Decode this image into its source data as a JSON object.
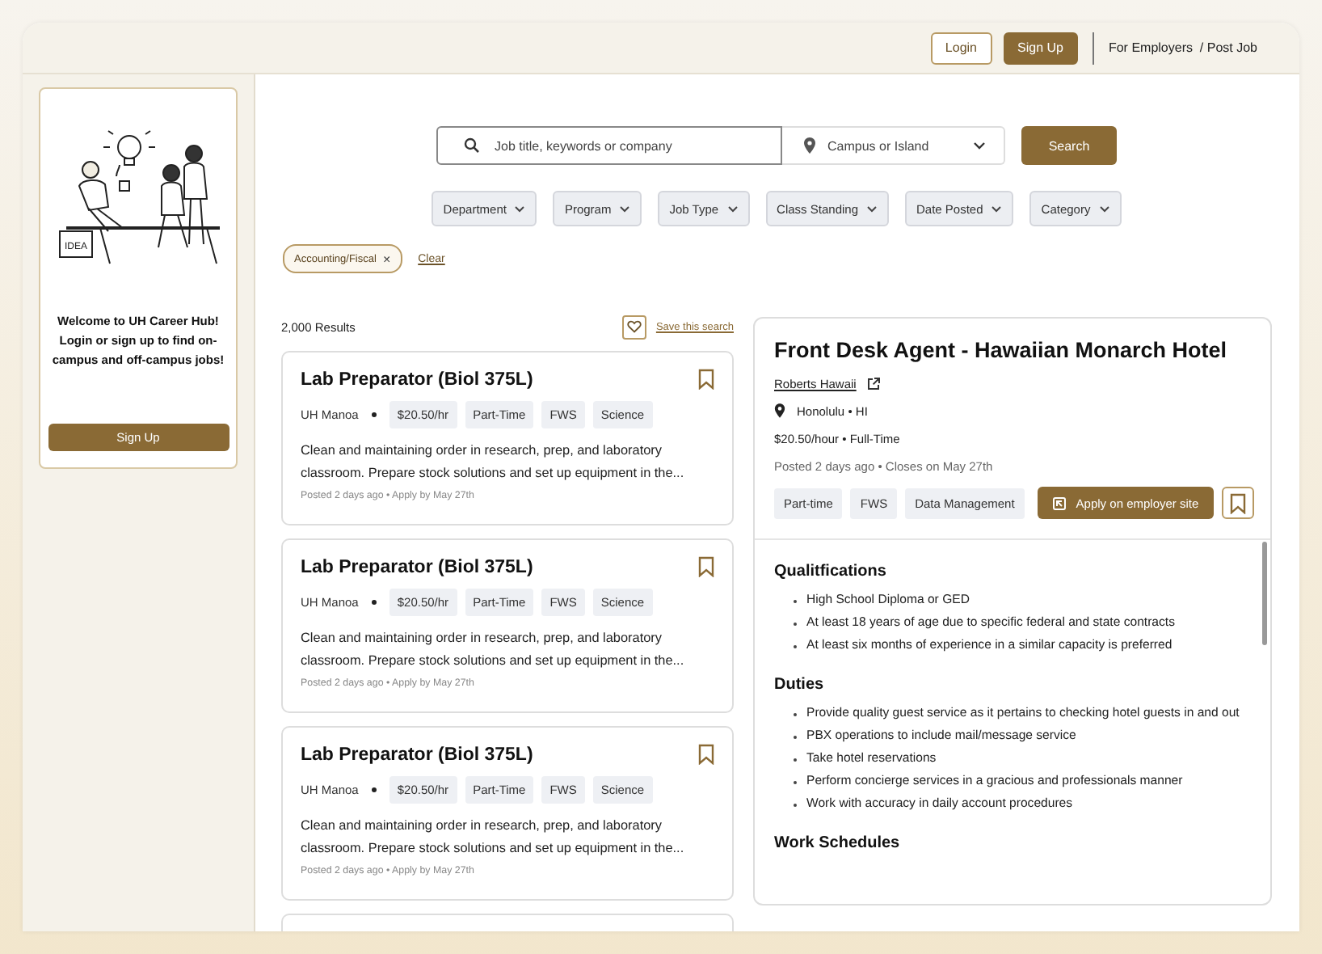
{
  "header": {
    "buttons": [
      {
        "label": "Login",
        "kind": "outline"
      },
      {
        "label": "Sign Up",
        "kind": "filled"
      }
    ],
    "employer_link": "For Employers  / Post Job"
  },
  "sidebar": {
    "illustration_label": "IDEA",
    "welcome": "Welcome to UH Career Hub! Login or sign up to find on-campus and off-campus jobs!",
    "button": "Sign Up"
  },
  "search": {
    "placeholder": "Job title, keywords or company",
    "location_placeholder": "Campus or Island",
    "button": "Search"
  },
  "filters": [
    "Department",
    "Program",
    "Job Type",
    "Class Standing",
    "Date Posted",
    "Category"
  ],
  "active_filters": [
    {
      "label": "Accounting/Fiscal",
      "remove": "×"
    }
  ],
  "clear": "Clear",
  "results": {
    "count": "2,000 Results",
    "save_search": "Save this search"
  },
  "jobs": [
    {
      "title": "Lab Preparator (Biol 375L)",
      "employer": "UH Manoa",
      "tags": [
        "$20.50/hr",
        "Part-Time",
        "FWS",
        "Science"
      ],
      "description": "Clean and maintaining order in research, prep, and laboratory classroom. Prepare stock solutions and set up equipment in the...",
      "meta": "Posted 2 days ago • Apply by May 27th",
      "bookmarked": false
    },
    {
      "title": "Lab Preparator (Biol 375L)",
      "employer": "UH Manoa",
      "tags": [
        "$20.50/hr",
        "Part-Time",
        "FWS",
        "Science"
      ],
      "description": "Clean and maintaining order in research, prep, and laboratory classroom. Prepare stock solutions and set up equipment in the...",
      "meta": "Posted 2 days ago • Apply by May 27th",
      "bookmarked": false
    },
    {
      "title": "Lab Preparator (Biol 375L)",
      "employer": "UH Manoa",
      "tags": [
        "$20.50/hr",
        "Part-Time",
        "FWS",
        "Science"
      ],
      "description": "Clean and maintaining order in research, prep, and laboratory classroom. Prepare stock solutions and set up equipment in the...",
      "meta": "Posted 2 days ago • Apply by May 27th",
      "bookmarked": false
    }
  ],
  "detail": {
    "title": "Front Desk Agent - Hawaiian Monarch Hotel",
    "company": "Roberts Hawaii",
    "location": "Honolulu • HI",
    "pay": "$20.50/hour • Full-Time",
    "posted": "Posted 2 days ago • Closes on May 27th",
    "tags": [
      "Part-time",
      "FWS",
      "Data Management"
    ],
    "apply": "Apply on employer site",
    "bookmarked": false,
    "sections": [
      {
        "heading": "Qualitfications",
        "items": [
          "High School Diploma or GED",
          "At least 18 years of age due to specific federal and state contracts",
          "At least six months of experience in a similar capacity is preferred"
        ]
      },
      {
        "heading": "Duties",
        "items": [
          "Provide quality guest service as it pertains to checking hotel guests in and out",
          "PBX operations to include mail/message service",
          "Take hotel reservations",
          "Perform concierge services in a gracious and professionals manner",
          "Work with accuracy in daily account procedures"
        ]
      },
      {
        "heading": "Work Schedules"
      }
    ]
  }
}
